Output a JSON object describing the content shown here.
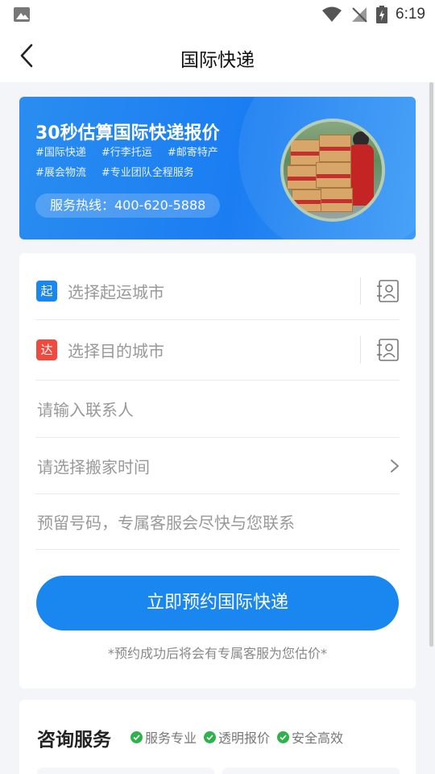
{
  "status_bar": {
    "time": "6:19"
  },
  "header": {
    "title": "国际快递"
  },
  "banner": {
    "title": "30秒估算国际快递报价",
    "tags": [
      "#国际快递",
      "#行李托运",
      "#邮寄特产",
      "#展会物流",
      "#专业团队全程服务"
    ],
    "hotline": "服务热线：400-620-5888"
  },
  "form": {
    "origin": {
      "badge": "起",
      "placeholder": "选择起运城市"
    },
    "destination": {
      "badge": "达",
      "placeholder": "选择目的城市"
    },
    "contact_placeholder": "请输入联系人",
    "time_placeholder": "请选择搬家时间",
    "phone_placeholder": "预留号码，专属客服会尽快与您联系",
    "submit_label": "立即预约国际快递",
    "hint": "*预约成功后将会有专属客服为您估价*"
  },
  "consult": {
    "title": "咨询服务",
    "features": [
      "服务专业",
      "透明报价",
      "安全高效"
    ]
  },
  "colors": {
    "primary": "#1a86f0",
    "origin_badge": "#1a86f0",
    "dest_badge": "#f04a3e",
    "check": "#2fb24c"
  },
  "icons": [
    "gallery-icon",
    "wifi-icon",
    "no-signal-icon",
    "battery-icon",
    "back-arrow-icon",
    "contact-book-icon",
    "chevron-right-icon",
    "check-icon"
  ]
}
